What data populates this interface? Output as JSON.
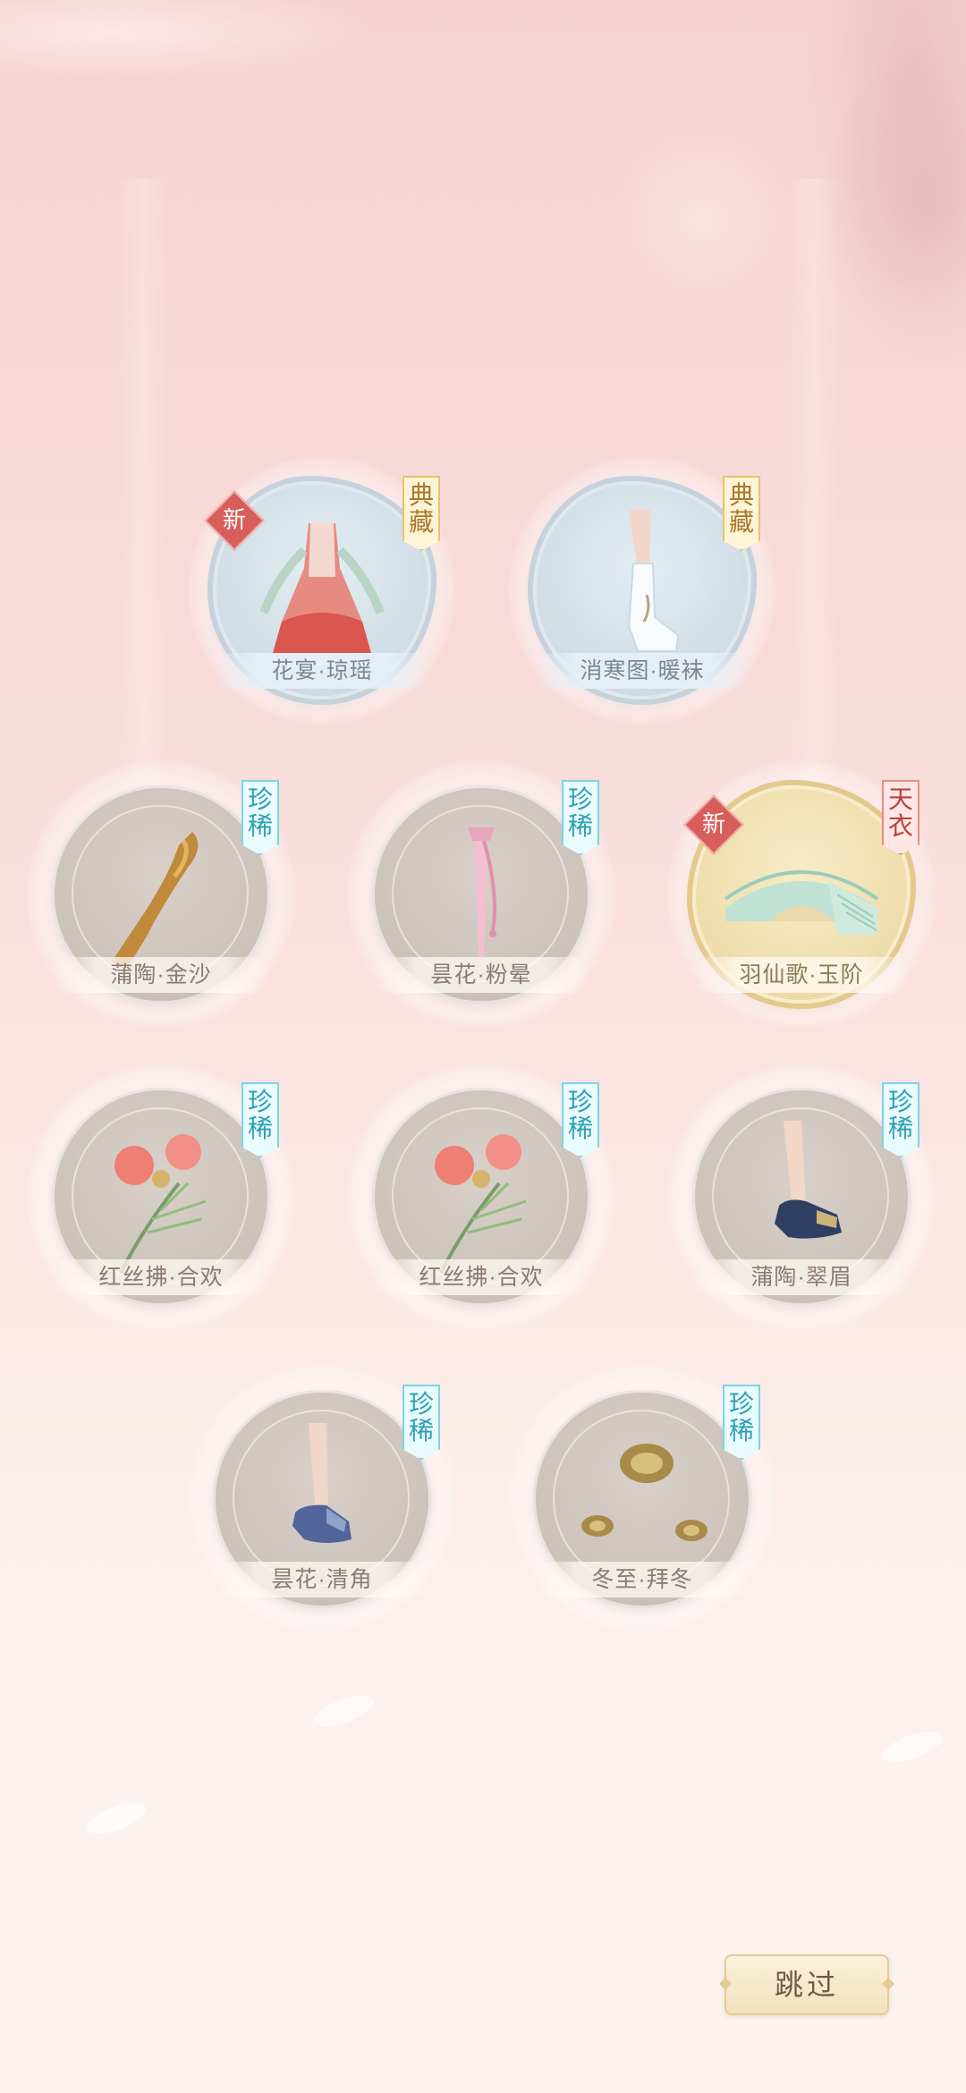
{
  "items": [
    {
      "name": "花宴·琼瑶",
      "tag": "典藏",
      "is_new": true,
      "frame": "blue",
      "icon": "dress-icon"
    },
    {
      "name": "消寒图·暖袜",
      "tag": "典藏",
      "is_new": false,
      "frame": "blue",
      "icon": "sock-icon"
    },
    {
      "name": "蒲陶·金沙",
      "tag": "珍稀",
      "is_new": false,
      "frame": "gray",
      "icon": "gold-sash-icon"
    },
    {
      "name": "昙花·粉晕",
      "tag": "珍稀",
      "is_new": false,
      "frame": "gray",
      "icon": "pink-ribbon-icon"
    },
    {
      "name": "羽仙歌·玉阶",
      "tag": "天衣",
      "is_new": true,
      "frame": "gold",
      "icon": "jade-bridge-icon"
    },
    {
      "name": "红丝拂·合欢",
      "tag": "珍稀",
      "is_new": false,
      "frame": "gray",
      "icon": "silk-flower-icon"
    },
    {
      "name": "红丝拂·合欢",
      "tag": "珍稀",
      "is_new": false,
      "frame": "gray",
      "icon": "silk-flower-icon"
    },
    {
      "name": "蒲陶·翠眉",
      "tag": "珍稀",
      "is_new": false,
      "frame": "gray",
      "icon": "navy-shoe-icon"
    },
    {
      "name": "昙花·清角",
      "tag": "珍稀",
      "is_new": false,
      "frame": "gray",
      "icon": "blue-shoe-icon"
    },
    {
      "name": "冬至·拜冬",
      "tag": "珍稀",
      "is_new": false,
      "frame": "gray",
      "icon": "gold-hairpin-icon"
    }
  ],
  "new_badge": "新",
  "skip_button": "跳过",
  "colors": {
    "rare": "#2f9fb4",
    "classic": "#a87a2b",
    "celestial": "#b7423f",
    "new": "#d85e5a"
  }
}
